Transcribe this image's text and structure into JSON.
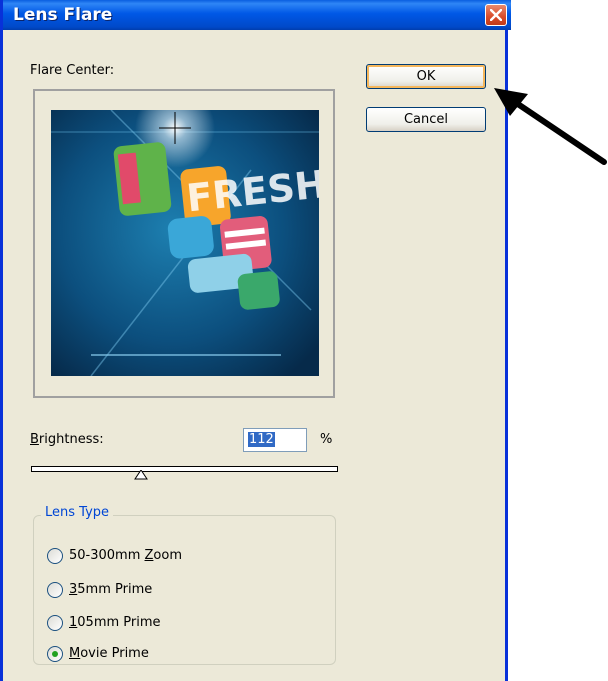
{
  "window": {
    "title": "Lens Flare"
  },
  "labels": {
    "flare_center": "Flare Center:",
    "brightness_prefix": "B",
    "brightness_rest": "rightness:",
    "percent": "%"
  },
  "buttons": {
    "ok": "OK",
    "cancel": "Cancel"
  },
  "brightness": {
    "value": "112",
    "slider_fraction": 0.35
  },
  "lens_type": {
    "legend": "Lens Type",
    "options": [
      {
        "pre": "50-300mm ",
        "key": "Z",
        "post": "oom",
        "selected": false
      },
      {
        "pre": "",
        "key": "3",
        "post": "5mm Prime",
        "selected": false
      },
      {
        "pre": "",
        "key": "1",
        "post": "05mm Prime",
        "selected": false
      },
      {
        "pre": "",
        "key": "M",
        "post": "ovie Prime",
        "selected": true
      }
    ]
  },
  "preview": {
    "text_art": "FRESH"
  },
  "colors": {
    "title_bar": "#0058e6",
    "close_button": "#d94b2a",
    "ok_highlight": "#f5b75c",
    "radio_selected": "#21a121"
  },
  "icons": {
    "close": "close-x-icon",
    "annotation": "arrow-icon"
  }
}
